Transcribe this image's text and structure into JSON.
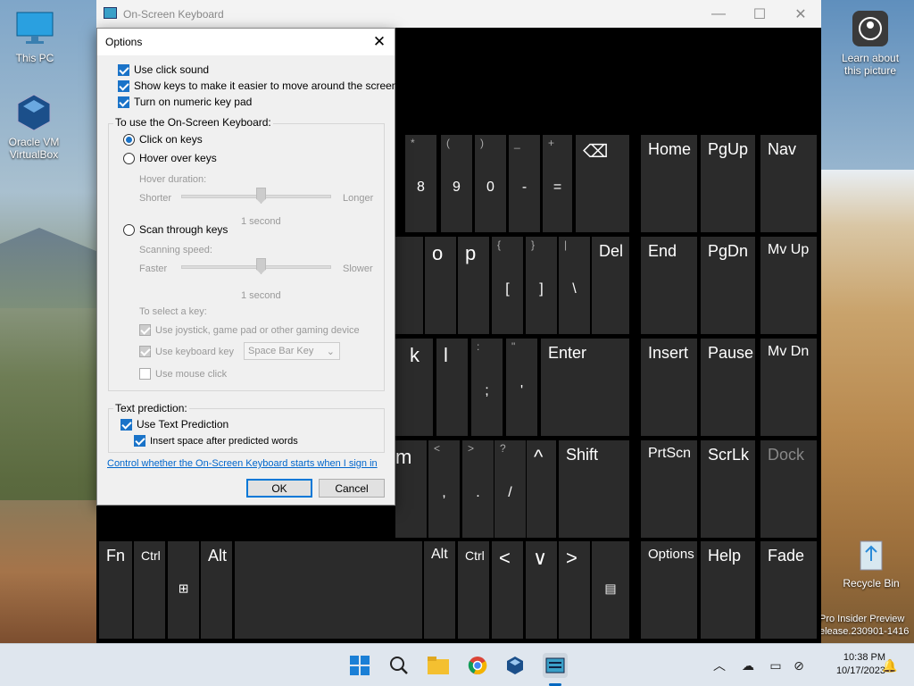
{
  "desktop": {
    "icons": [
      {
        "label": "This PC"
      },
      {
        "label": "Oracle VM VirtualBox"
      },
      {
        "label": "Learn about this picture"
      },
      {
        "label": "Recycle Bin"
      }
    ],
    "watermark": [
      "Pro Insider Preview",
      "elease.230901-1416"
    ]
  },
  "osk": {
    "title": "On-Screen Keyboard",
    "controls": {
      "minimize": "—",
      "maximize": "☐",
      "close": "✕"
    },
    "keys": {
      "row1": [
        {
          "top": "*",
          "main": "8"
        },
        {
          "top": "(",
          "main": "9"
        },
        {
          "top": ")",
          "main": "0"
        },
        {
          "top": "_",
          "main": "-"
        },
        {
          "top": "+",
          "main": "="
        },
        {
          "main": "⌫"
        },
        {
          "main": "Home"
        },
        {
          "main": "PgUp"
        },
        {
          "main": "Nav"
        }
      ],
      "row2": [
        {
          "main": "o"
        },
        {
          "main": "p"
        },
        {
          "top": "{",
          "main": "["
        },
        {
          "top": "}",
          "main": "]"
        },
        {
          "top": "|",
          "main": "\\"
        },
        {
          "main": "Del"
        },
        {
          "main": "End"
        },
        {
          "main": "PgDn"
        },
        {
          "main": "Mv Up"
        }
      ],
      "row3": [
        {
          "main": "k"
        },
        {
          "main": "l"
        },
        {
          "top": ":",
          "main": ";"
        },
        {
          "top": "\"",
          "main": "'"
        },
        {
          "main": "Enter"
        },
        {
          "main": "Insert"
        },
        {
          "main": "Pause"
        },
        {
          "main": "Mv Dn"
        }
      ],
      "row4": [
        {
          "main": "m"
        },
        {
          "top": "<",
          "main": ","
        },
        {
          "top": ">",
          "main": "."
        },
        {
          "top": "?",
          "main": "/"
        },
        {
          "main": "^"
        },
        {
          "main": "Shift"
        },
        {
          "main": "PrtScn"
        },
        {
          "main": "ScrLk"
        },
        {
          "main": "Dock"
        }
      ],
      "row5": [
        {
          "main": "Fn"
        },
        {
          "main": "Ctrl"
        },
        {
          "main": "⊞"
        },
        {
          "main": "Alt"
        },
        {
          "main": ""
        },
        {
          "main": "Alt"
        },
        {
          "main": "Ctrl"
        },
        {
          "main": "<"
        },
        {
          "main": "∨"
        },
        {
          "main": ">"
        },
        {
          "main": "▤"
        },
        {
          "main": "Options"
        },
        {
          "main": "Help"
        },
        {
          "main": "Fade"
        }
      ]
    }
  },
  "options_dialog": {
    "title": "Options",
    "checkboxes_top": [
      {
        "label": "Use click sound",
        "checked": true
      },
      {
        "label": "Show keys to make it easier to move around the screen",
        "checked": true
      },
      {
        "label": "Turn on numeric key pad",
        "checked": true
      }
    ],
    "use_group": {
      "label": "To use the On-Screen Keyboard:",
      "click_on_keys": "Click on keys",
      "hover_over_keys": "Hover over keys",
      "hover_duration": "Hover duration:",
      "hover_shorter": "Shorter",
      "hover_longer": "Longer",
      "hover_value": "1 second",
      "scan_through_keys": "Scan through keys",
      "scanning_speed": "Scanning speed:",
      "scan_faster": "Faster",
      "scan_slower": "Slower",
      "scan_value": "1 second",
      "select_key_label": "To select a key:",
      "joystick": "Use joystick, game pad or other gaming device",
      "keyboard_key": "Use keyboard key",
      "keyboard_key_value": "Space Bar Key",
      "mouse_click": "Use mouse click"
    },
    "text_prediction": {
      "label": "Text prediction:",
      "use_text_prediction": "Use Text Prediction",
      "insert_space": "Insert space after predicted words"
    },
    "link": "Control whether the On-Screen Keyboard starts when I sign in",
    "ok": "OK",
    "cancel": "Cancel"
  },
  "taskbar": {
    "time": "10:38 PM",
    "date": "10/17/2023"
  }
}
